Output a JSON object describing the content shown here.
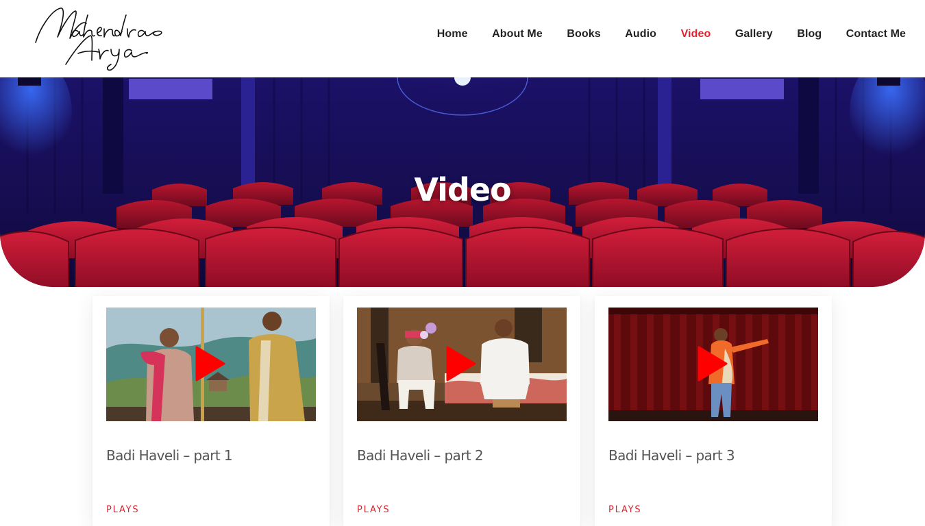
{
  "site": {
    "logo_text": "Mahendra Arya"
  },
  "nav": {
    "items": [
      {
        "label": "Home"
      },
      {
        "label": "About Me"
      },
      {
        "label": "Books"
      },
      {
        "label": "Audio"
      },
      {
        "label": "Video",
        "active": true
      },
      {
        "label": "Gallery"
      },
      {
        "label": "Blog"
      },
      {
        "label": "Contact Me"
      }
    ],
    "active_color": "#e0212b"
  },
  "hero": {
    "title": "Video"
  },
  "videos": [
    {
      "title": "Badi Haveli – part 1",
      "category": "PLAYS",
      "thumb_icon": "play-icon"
    },
    {
      "title": "Badi Haveli – part 2",
      "category": "PLAYS",
      "thumb_icon": "play-icon"
    },
    {
      "title": "Badi Haveli – part 3",
      "category": "PLAYS",
      "thumb_icon": "play-icon"
    }
  ],
  "colors": {
    "accent": "#e0212b",
    "seat_red": "#b0122e",
    "theater_blue": "#1a1460"
  }
}
